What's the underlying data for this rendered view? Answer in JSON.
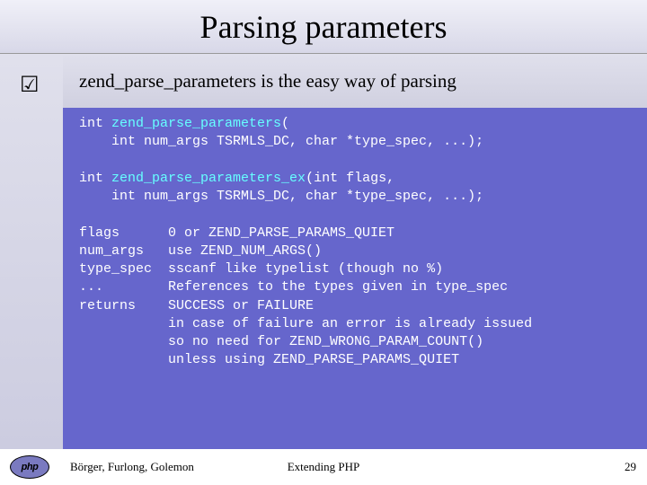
{
  "title": "Parsing parameters",
  "bullet_icon": "☑",
  "intro": "zend_parse_parameters is the easy way of parsing",
  "code": {
    "sig1_l1_pre": "int ",
    "sig1_l1_fn": "zend_parse_parameters",
    "sig1_l1_post": "(",
    "sig1_l2": "    int num_args TSRMLS_DC, char *type_spec, ...);",
    "blank": "",
    "sig2_l1_pre": "int ",
    "sig2_l1_fn": "zend_parse_parameters_ex",
    "sig2_l1_post": "(int flags,",
    "sig2_l2": "    int num_args TSRMLS_DC, char *type_spec, ...);",
    "p1": "flags      0 or ZEND_PARSE_PARAMS_QUIET",
    "p2": "num_args   use ZEND_NUM_ARGS()",
    "p3": "type_spec  sscanf like typelist (though no %)",
    "p4": "...        References to the types given in type_spec",
    "p5": "returns    SUCCESS or FAILURE",
    "p6": "           in case of failure an error is already issued",
    "p7": "           so no need for ZEND_WRONG_PARAM_COUNT()",
    "p8": "           unless using ZEND_PARSE_PARAMS_QUIET"
  },
  "footer": {
    "logo_text": "php",
    "authors": "Börger, Furlong, Golemon",
    "center": "Extending PHP",
    "page": "29"
  }
}
